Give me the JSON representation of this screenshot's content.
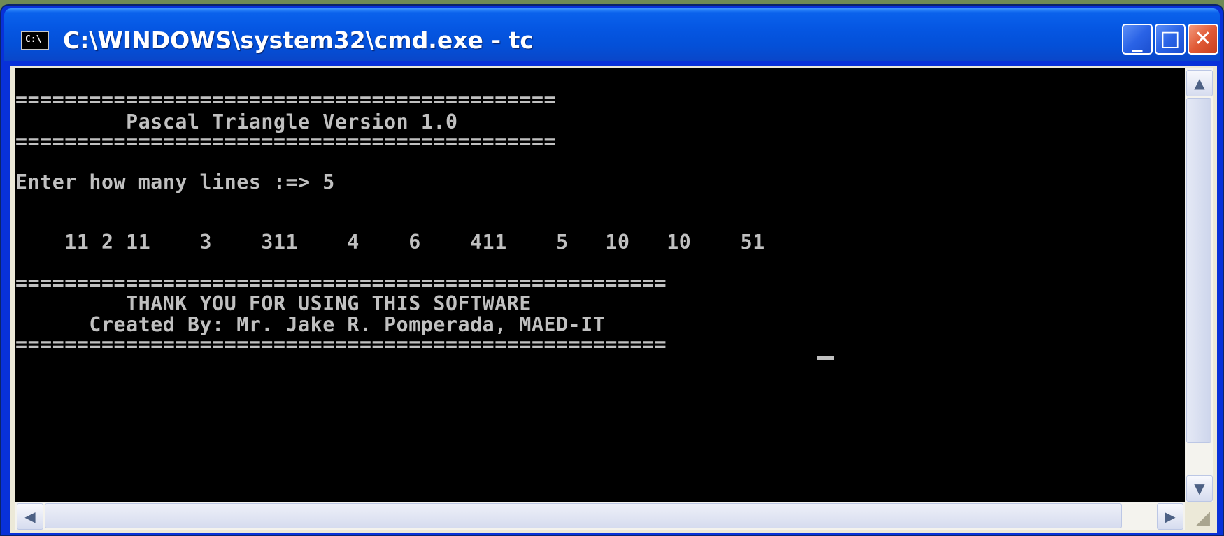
{
  "window": {
    "title": "C:\\WINDOWS\\system32\\cmd.exe - tc",
    "icon_label": "C:\\",
    "controls": {
      "minimize": "_",
      "maximize": "□",
      "close": "✕"
    }
  },
  "console": {
    "lines": [
      "============================================",
      "         Pascal Triangle Version 1.0",
      "============================================",
      "",
      "Enter how many lines :=> 5",
      "",
      "",
      "    11 2 11    3    311    4    6    411    5   10   10    51",
      "",
      "=====================================================",
      "         THANK YOU FOR USING THIS SOFTWARE",
      "      Created By: Mr. Jake R. Pomperada, MAED-IT",
      "====================================================="
    ]
  },
  "scrollbars": {
    "up_arrow": "▲",
    "down_arrow": "▼",
    "left_arrow": "◀",
    "right_arrow": "▶"
  },
  "colors": {
    "titlebar": "#0556e2",
    "console_bg": "#000000",
    "console_text": "#c0c0c0"
  },
  "icons": [
    "cmd-icon",
    "minimize-icon",
    "maximize-icon",
    "close-icon",
    "scroll-up-icon",
    "scroll-down-icon",
    "scroll-left-icon",
    "scroll-right-icon",
    "resize-grip-icon"
  ]
}
